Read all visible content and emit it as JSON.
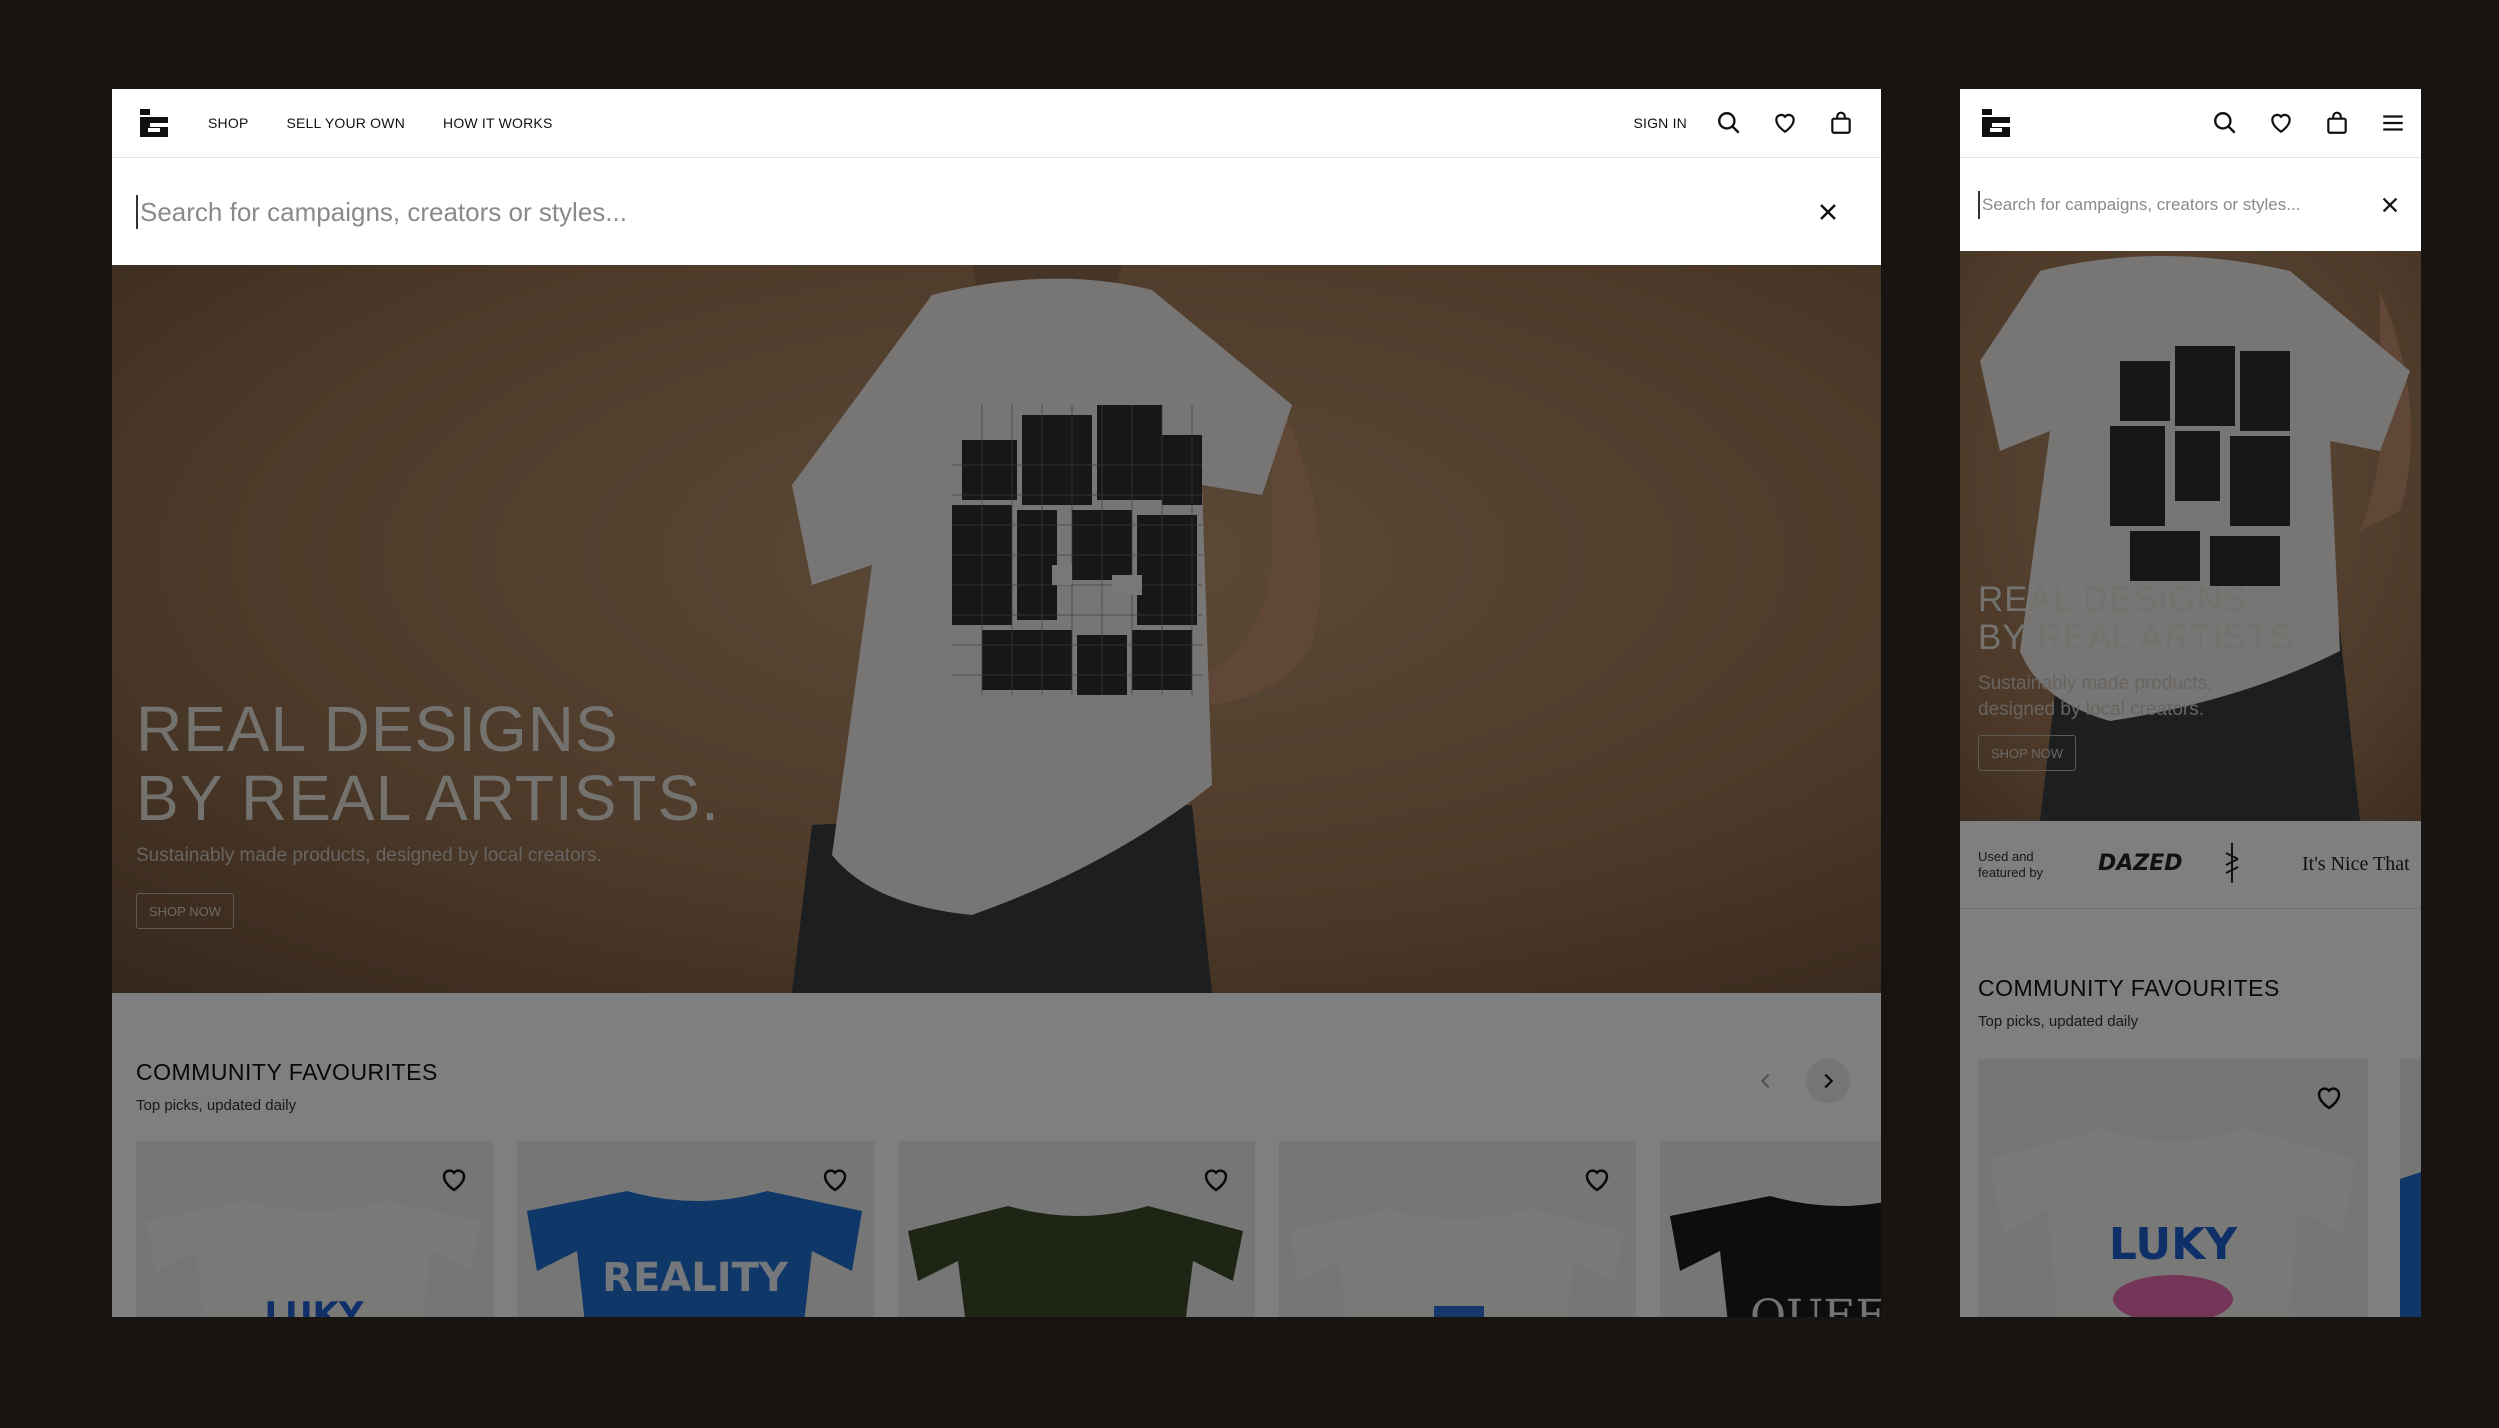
{
  "nav": {
    "shop": "SHOP",
    "sell": "SELL YOUR OWN",
    "how": "HOW IT WORKS",
    "sign_in": "SIGN IN"
  },
  "search": {
    "placeholder": "Search for campaigns, creators or styles..."
  },
  "hero": {
    "title_line1": "REAL DESIGNS",
    "title_line2": "BY REAL ARTISTS.",
    "subtitle": "Sustainably made products, designed by local creators.",
    "subtitle_line1": "Sustainably made products,",
    "subtitle_line2": "designed by local creators.",
    "button": "SHOP NOW"
  },
  "brands": {
    "label_line1": "Used and",
    "label_line2": "featured by",
    "items": [
      "DAZED",
      "It's Nice That"
    ]
  },
  "community": {
    "title": "COMMUNITY FAVOURITES",
    "subtitle": "Top picks, updated daily"
  },
  "products": [
    {
      "print": "LUKY",
      "color": "#f2f2f0"
    },
    {
      "print": "REALITY",
      "color": "#1f6fd1"
    },
    {
      "print": "",
      "color": "#3d4a2b"
    },
    {
      "print": "",
      "color": "#f2f2f0"
    },
    {
      "print": "QUEEN",
      "color": "#1a1a1a"
    }
  ],
  "colors": {
    "backdrop": "#181412",
    "hero_brown": "#a57b55",
    "dim_overlay": "rgba(0,0,0,0.5)"
  }
}
